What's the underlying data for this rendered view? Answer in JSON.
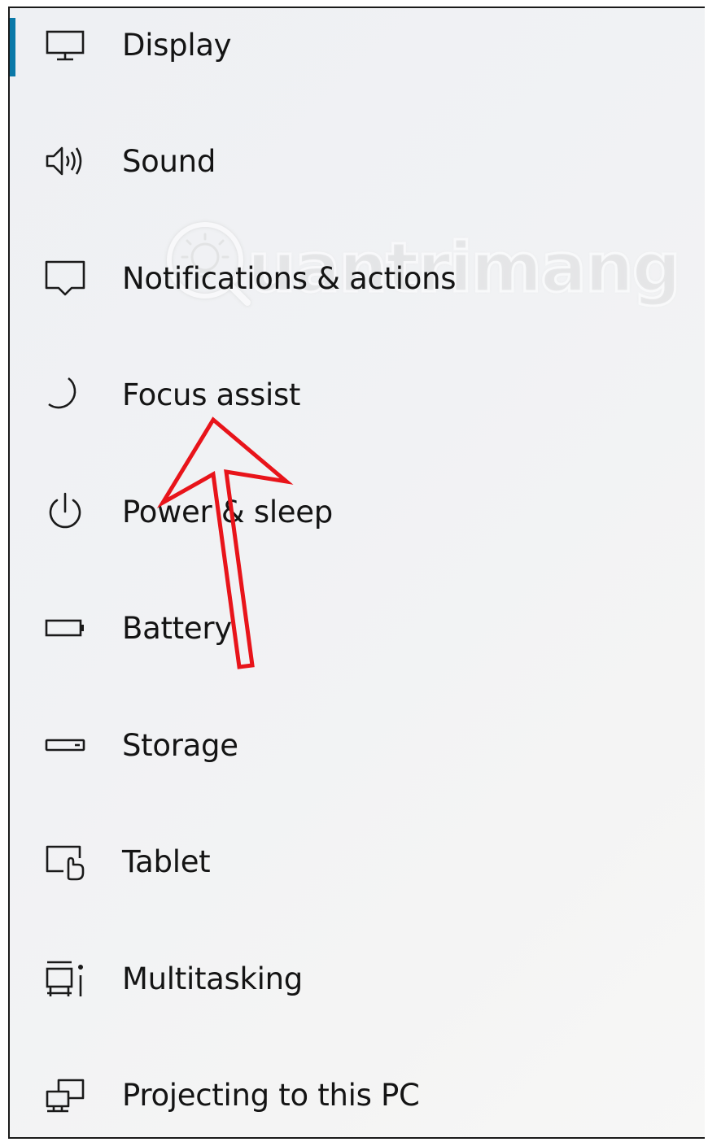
{
  "accent_color": "#0a79a8",
  "annotation_color": "#e8141a",
  "selected_item": "Display",
  "nav": {
    "items": [
      {
        "label": "Display",
        "icon": "display-icon"
      },
      {
        "label": "Sound",
        "icon": "speaker-icon"
      },
      {
        "label": "Notifications & actions",
        "icon": "notification-icon"
      },
      {
        "label": "Focus assist",
        "icon": "moon-icon"
      },
      {
        "label": "Power & sleep",
        "icon": "power-icon"
      },
      {
        "label": "Battery",
        "icon": "battery-icon"
      },
      {
        "label": "Storage",
        "icon": "storage-icon"
      },
      {
        "label": "Tablet",
        "icon": "tablet-icon"
      },
      {
        "label": "Multitasking",
        "icon": "multitasking-icon"
      },
      {
        "label": "Projecting to this PC",
        "icon": "projecting-icon"
      }
    ]
  },
  "watermark": {
    "text": "uantrimang",
    "icon": "lightbulb-icon"
  }
}
